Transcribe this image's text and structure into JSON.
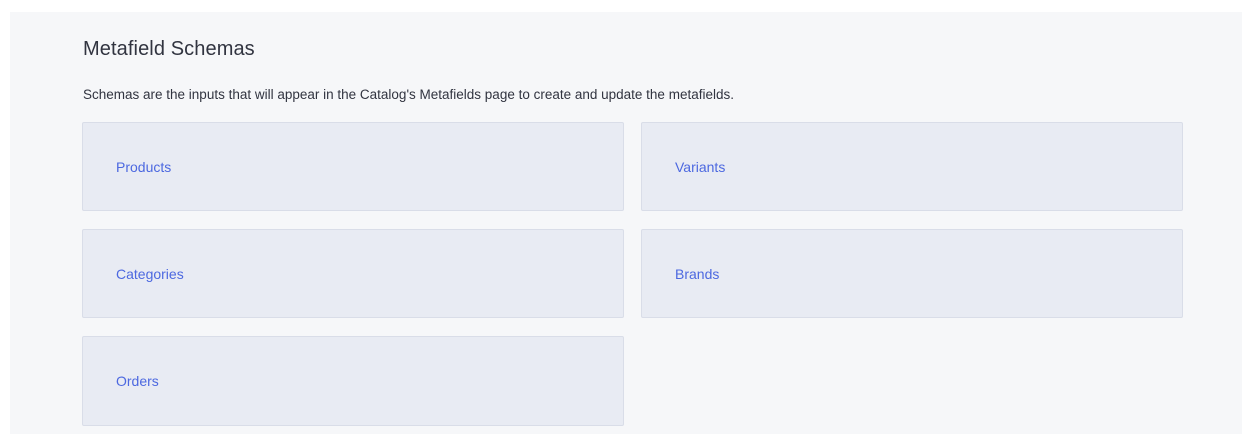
{
  "header": {
    "title": "Metafield Schemas",
    "description": "Schemas are the inputs that will appear in the Catalog's Metafields page to create and update the metafields."
  },
  "schemas": [
    {
      "label": "Products"
    },
    {
      "label": "Variants"
    },
    {
      "label": "Categories"
    },
    {
      "label": "Brands"
    },
    {
      "label": "Orders"
    }
  ],
  "colors": {
    "page_background": "#f6f7f9",
    "card_background": "#e8ebf3",
    "card_border": "#d9dde8",
    "link_text": "#4c68e0",
    "body_text": "#313440"
  }
}
